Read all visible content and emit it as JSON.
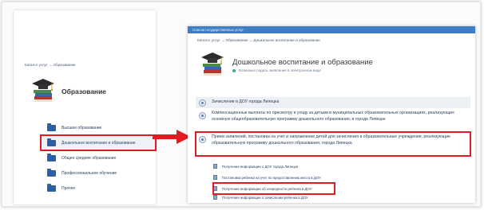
{
  "left": {
    "breadcrumb": "Каталог услуг → Образование",
    "title": "Образование",
    "menu": [
      {
        "label": "Высшее образование"
      },
      {
        "label": "Дошкольное воспитание и образование"
      },
      {
        "label": "Общее среднее образование"
      },
      {
        "label": "Профессиональное обучение"
      },
      {
        "label": "Прочее"
      }
    ]
  },
  "right": {
    "topbar": "Список государственных услуг",
    "breadcrumb": "Каталог услуг → Образование → Дошкольное воспитание и образование",
    "title": "Дошкольное воспитание и образование",
    "subtitle": "Возможно подать заявление в электронном виде",
    "sections": [
      {
        "label": "Зачисление в ДОУ города Липецка"
      },
      {
        "label": "Компенсационные выплаты по присмотру и уходу за детьми в муниципальных образовательных организациях, реализующих основную общеобразовательную программу дошкольного образования, в городе Липецке"
      },
      {
        "label": "Прием заявлений, постановка на учет и направление детей для зачисления в образовательные учреждения, реализующие образовательную программу дошкольного образования, города Липецка"
      }
    ],
    "sub_items": [
      {
        "label": "Получение информации о ДОУ города Липецка"
      },
      {
        "label": "Постановка ребенка на учет по предоставлению места в ДОУ"
      },
      {
        "label": "Получение информации об очередности ребенка в ДОУ"
      },
      {
        "label": "Получение информации о зачислении ребенка в ДОУ"
      }
    ]
  },
  "colors": {
    "highlight": "#e21b22",
    "link": "#2a3e5c",
    "accent": "#3f7ec4",
    "folder": "#2a5fa7"
  },
  "icons": {
    "category": "graduation-cap-books-icon",
    "folder": "folder-icon",
    "arrow": "red-arrow-right-icon",
    "document": "document-icon"
  }
}
